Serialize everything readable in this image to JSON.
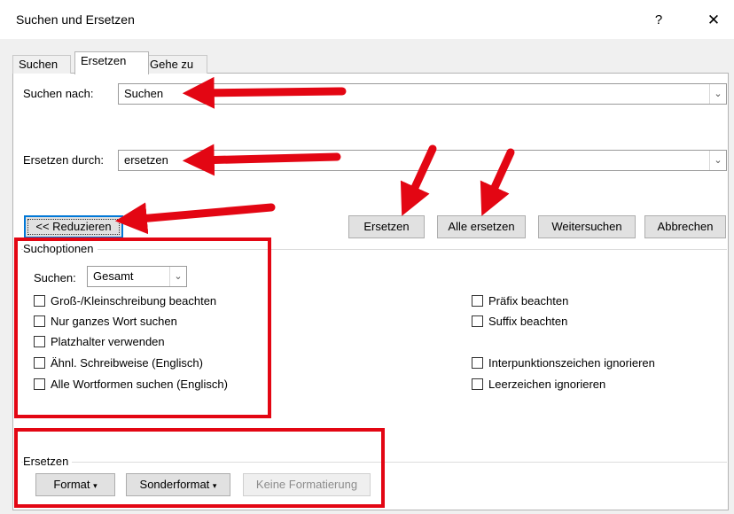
{
  "window": {
    "title": "Suchen und Ersetzen",
    "help_label": "?",
    "close_label": "✕"
  },
  "tabs": [
    {
      "label": "Suchen"
    },
    {
      "label": "Ersetzen",
      "active": true
    },
    {
      "label": "Gehe zu"
    }
  ],
  "search": {
    "label": "Suchen nach:",
    "value": "Suchen"
  },
  "replace": {
    "label": "Ersetzen durch:",
    "value": "ersetzen"
  },
  "buttons": {
    "reduce": "<< Reduzieren",
    "replace": "Ersetzen",
    "replace_all": "Alle ersetzen",
    "find_next": "Weitersuchen",
    "cancel": "Abbrechen"
  },
  "search_options": {
    "title": "Suchoptionen",
    "scope_label": "Suchen:",
    "scope_value": "Gesamt",
    "left_options": [
      "Groß-/Kleinschreibung beachten",
      "Nur ganzes Wort suchen",
      "Platzhalter verwenden",
      "Ähnl. Schreibweise (Englisch)",
      "Alle Wortformen suchen (Englisch)"
    ],
    "right_options": [
      "Präfix beachten",
      "Suffix beachten",
      "Interpunktionszeichen ignorieren",
      "Leerzeichen ignorieren"
    ]
  },
  "replace_section": {
    "title": "Ersetzen",
    "format": "Format",
    "special_format": "Sonderformat",
    "no_formatting": "Keine Formatierung"
  },
  "colors": {
    "annotation_red": "#e30613",
    "focus_blue": "#0078d7"
  }
}
